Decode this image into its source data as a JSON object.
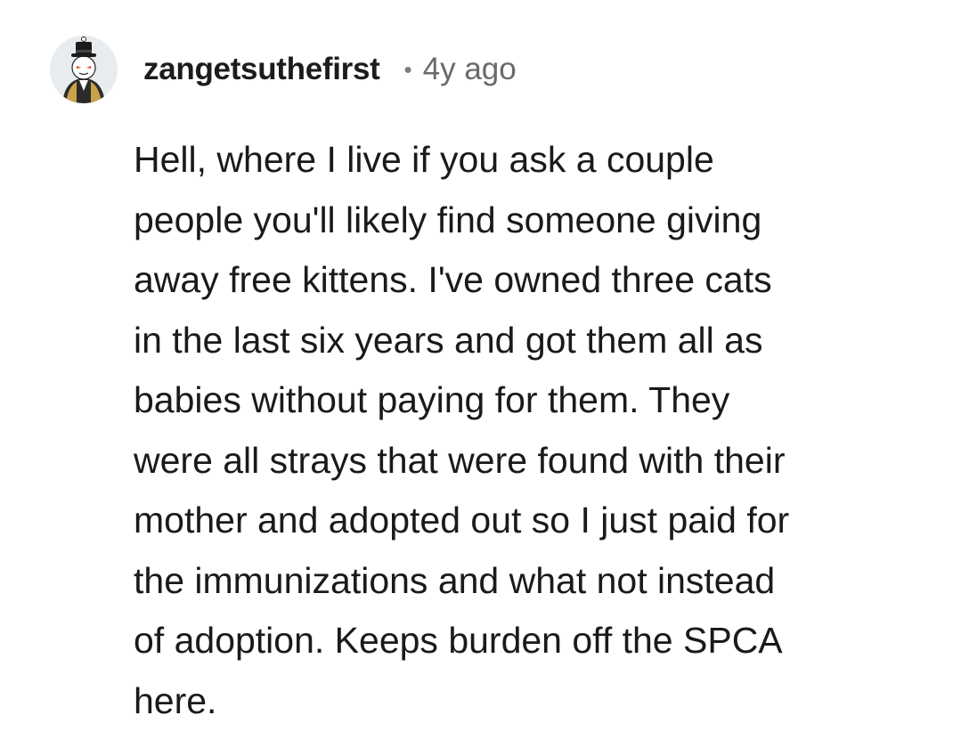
{
  "comment": {
    "author": "zangetsuthefirst",
    "separator": "•",
    "age": "4y ago",
    "avatar_icon": "user-avatar-icon",
    "body_lines": [
      "Hell, where I live if you ask a couple",
      "people you'll likely find someone giving",
      "away free kittens. I've owned three cats",
      "in the last six years and got them all as",
      "babies without paying for them. They",
      "were all strays that were found with their",
      "mother and adopted out so I just paid for",
      "the immunizations and what not instead",
      "of adoption. Keeps burden off the SPCA",
      "here."
    ]
  }
}
